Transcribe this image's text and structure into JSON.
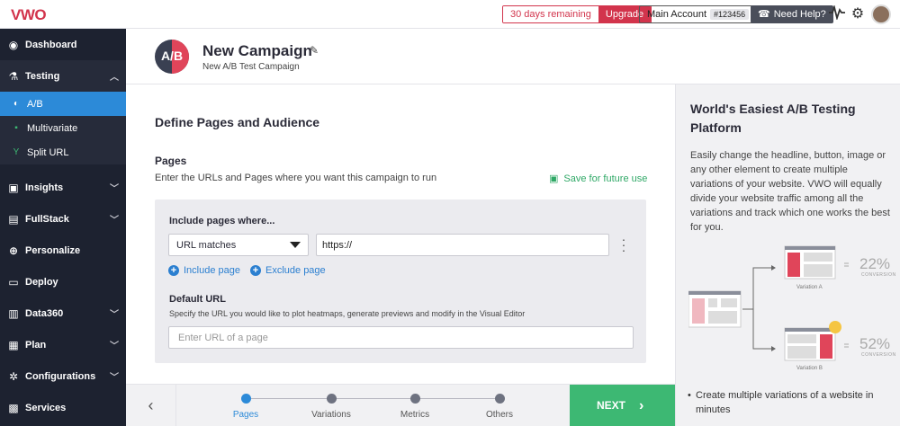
{
  "topbar": {
    "logo": "VWO",
    "trial_text": "30 days remaining",
    "upgrade_label": "Upgrade",
    "account_label": "Main Account",
    "account_id": "#123456",
    "help_label": "Need Help?"
  },
  "sidebar": {
    "items": [
      {
        "label": "Dashboard",
        "icon": "dashboard-icon"
      },
      {
        "label": "Testing",
        "icon": "flask-icon"
      },
      {
        "label": "A/B",
        "icon": "ab-icon"
      },
      {
        "label": "Multivariate",
        "icon": "grid-icon"
      },
      {
        "label": "Split URL",
        "icon": "split-icon"
      },
      {
        "label": "Insights",
        "icon": "insights-icon"
      },
      {
        "label": "FullStack",
        "icon": "stack-icon"
      },
      {
        "label": "Personalize",
        "icon": "target-icon"
      },
      {
        "label": "Deploy",
        "icon": "deploy-icon"
      },
      {
        "label": "Data360",
        "icon": "data-icon"
      },
      {
        "label": "Plan",
        "icon": "plan-icon"
      },
      {
        "label": "Configurations",
        "icon": "gear-icon"
      },
      {
        "label": "Services",
        "icon": "services-icon"
      }
    ]
  },
  "header": {
    "badge": "A/B",
    "title": "New Campaign",
    "subtitle": "New A/B Test Campaign"
  },
  "main": {
    "section_title": "Define Pages and Audience",
    "pages_title": "Pages",
    "pages_desc": "Enter the URLs and Pages where you want this campaign to run",
    "save_label": "Save for future use",
    "include_title": "Include pages where...",
    "match_value": "URL matches",
    "url_value": "https://",
    "include_page_label": "Include page",
    "exclude_page_label": "Exclude page",
    "default_url_title": "Default URL",
    "default_url_desc": "Specify the URL you would like to plot heatmaps, generate previews and modify in the Visual Editor",
    "default_url_placeholder": "Enter URL of a page"
  },
  "footer": {
    "steps": [
      "Pages",
      "Variations",
      "Metrics",
      "Others"
    ],
    "active_step": "Pages",
    "next_label": "NEXT"
  },
  "right": {
    "title": "World's Easiest A/B Testing Platform",
    "desc": "Easily change the headline, button, image or any other element to create multiple variations of your website. VWO will equally divide your website traffic among all the variations and track which one works the best for you.",
    "variation_a_label": "Variation A",
    "variation_a_pct": "22%",
    "variation_b_label": "Variation B",
    "variation_b_pct": "52%",
    "conversion_label": "CONVERSION",
    "bullet": "Create multiple variations of a website in minutes"
  },
  "colors": {
    "accent_blue": "#2c8ad8",
    "brand_red": "#d2344c",
    "success_green": "#3db873",
    "sidebar_bg": "#1d2230"
  }
}
